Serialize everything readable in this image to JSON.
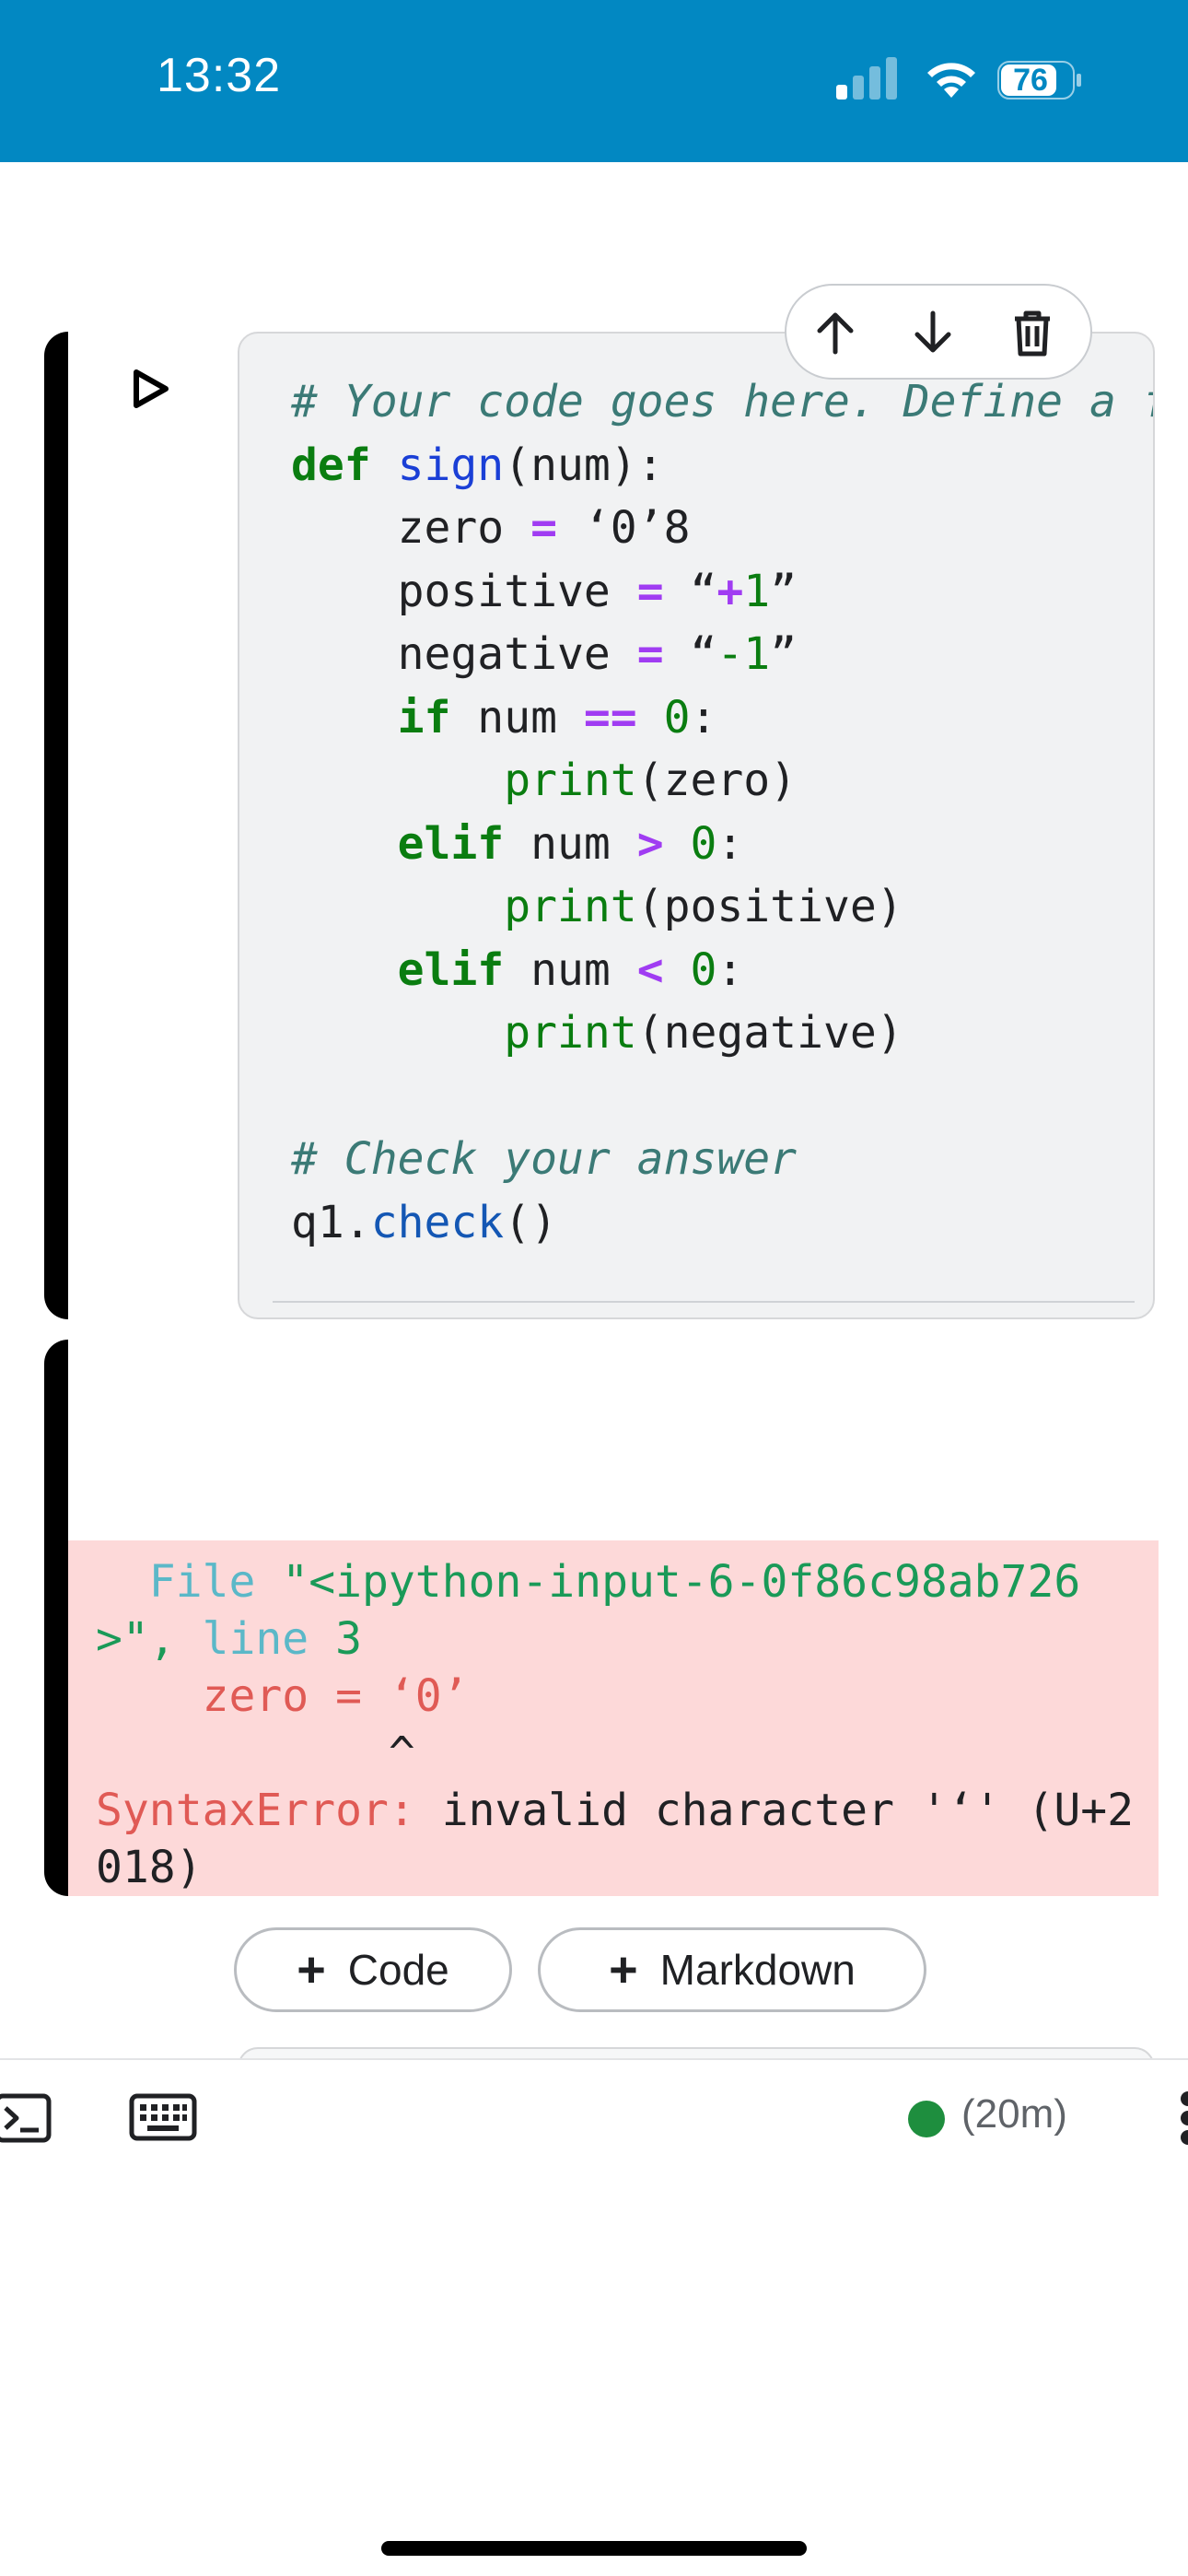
{
  "status_bar": {
    "time": "13:32",
    "battery": "76",
    "icons": [
      "signal-icon",
      "wifi-icon",
      "battery-icon"
    ]
  },
  "cell_toolbar": {
    "icons": [
      "arrow-up-icon",
      "arrow-down-icon",
      "trash-icon"
    ]
  },
  "code_cell": {
    "run_icon": "play-icon",
    "lines": [
      "# Your code goes here. Define a function",
      "def sign(num):",
      "    zero = ‘0’8",
      "    positive = “+1”",
      "    negative = “-1”",
      "    if num == 0:",
      "        print(zero)",
      "    elif num > 0:",
      "        print(positive)",
      "    elif num < 0:",
      "        print(negative)",
      "",
      "# Check your answer",
      "q1.check()"
    ]
  },
  "output": {
    "file_label": "File",
    "file_path": "\"<ipython-input-6-0f86c98ab726",
    "file_path_end": ">\",",
    "line_label": "line",
    "line_num": "3",
    "code_line": "zero = ‘0’",
    "caret": "^",
    "error_type": "SyntaxError:",
    "error_msg": "invalid character '‘' (U+2",
    "error_msg_end": "018)"
  },
  "add_buttons": {
    "code": "Code",
    "markdown": "Markdown",
    "plus": "+"
  },
  "bottom_bar": {
    "status_time": "(20m)",
    "status_color": "#1e8e3e",
    "icons": [
      "terminal-icon",
      "keyboard-icon",
      "more-vert-icon"
    ]
  },
  "colors": {
    "status_bar_bg": "#0288c2",
    "error_bg": "#fdd9d9"
  }
}
